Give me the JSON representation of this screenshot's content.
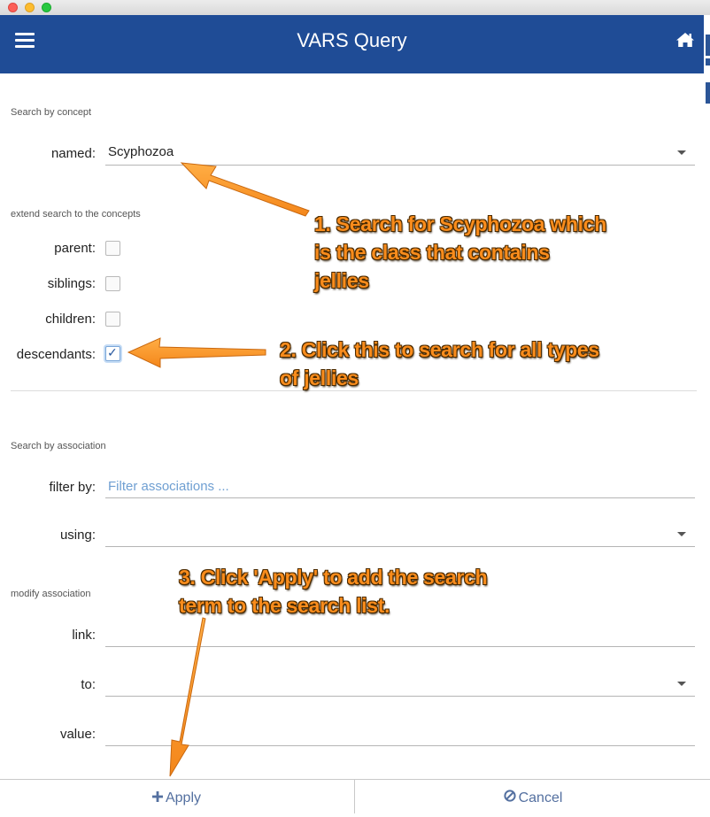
{
  "app": {
    "title": "VARS Query"
  },
  "concept_search": {
    "section_label": "Search by concept",
    "named_label": "named:",
    "named_value": "Scyphozoa"
  },
  "extend_search": {
    "section_label": "extend search to the concepts",
    "options": [
      {
        "label": "parent:",
        "checked": false
      },
      {
        "label": "siblings:",
        "checked": false
      },
      {
        "label": "children:",
        "checked": false
      },
      {
        "label": "descendants:",
        "checked": true
      }
    ]
  },
  "association_search": {
    "section_label": "Search by association",
    "filter_label": "filter by:",
    "filter_placeholder": "Filter associations ...",
    "using_label": "using:",
    "using_value": ""
  },
  "modify_association": {
    "section_label": "modify association",
    "link_label": "link:",
    "link_value": "",
    "to_label": "to:",
    "to_value": "",
    "value_label": "value:",
    "value_value": ""
  },
  "footer": {
    "apply_label": "Apply",
    "cancel_label": "Cancel"
  },
  "annotations": {
    "step1": [
      "1. Search for Scyphozoa which",
      "is the class that contains",
      "jellies"
    ],
    "step2": [
      "2. Click this to search for all types",
      "of jellies"
    ],
    "step3": [
      "3. Click 'Apply' to add the search",
      "term to the search list."
    ]
  },
  "colors": {
    "appbar": "#1f4c96",
    "annotation": "#f98c1c",
    "placeholder": "#6f9fd2",
    "footer_text": "#5470a0"
  }
}
